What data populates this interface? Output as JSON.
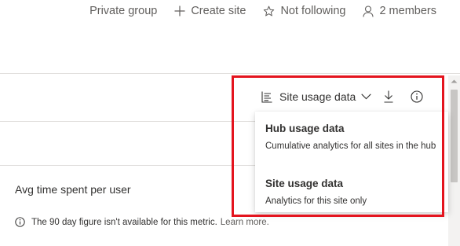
{
  "header": {
    "privacy": "Private group",
    "create_site": "Create site",
    "follow": "Not following",
    "members": "2 members"
  },
  "toolbar": {
    "selected_view": "Site usage data"
  },
  "dropdown": {
    "items": [
      {
        "title": "Hub usage data",
        "description": "Cumulative analytics for all sites in the hub"
      },
      {
        "title": "Site usage data",
        "description": "Analytics for this site only"
      }
    ]
  },
  "metric": {
    "label": "Avg time spent per user",
    "note": "The 90 day figure isn't available for this metric.",
    "learn_more": "Learn more."
  },
  "colors": {
    "highlight": "#e4141e",
    "text": "#323130",
    "muted": "#605e5c"
  }
}
